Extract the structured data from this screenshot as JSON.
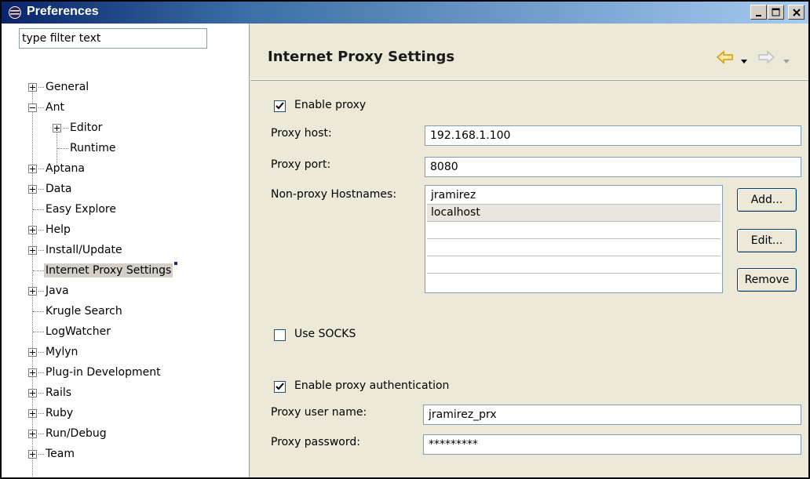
{
  "window": {
    "title": "Preferences",
    "controls": [
      "minimize",
      "maximize",
      "close"
    ]
  },
  "filter": {
    "placeholder": "type filter text",
    "value": "type filter text"
  },
  "tree": {
    "items": [
      {
        "label": "General",
        "expander": "plus"
      },
      {
        "label": "Ant",
        "expander": "minus"
      },
      {
        "label": "Editor",
        "expander": "plus"
      },
      {
        "label": "Runtime",
        "expander": "none"
      },
      {
        "label": "Aptana",
        "expander": "plus"
      },
      {
        "label": "Data",
        "expander": "plus"
      },
      {
        "label": "Easy Explore",
        "expander": "none"
      },
      {
        "label": "Help",
        "expander": "plus"
      },
      {
        "label": "Install/Update",
        "expander": "plus"
      },
      {
        "label": "Internet Proxy Settings",
        "expander": "none",
        "selected": true
      },
      {
        "label": "Java",
        "expander": "plus"
      },
      {
        "label": "Krugle Search",
        "expander": "none"
      },
      {
        "label": "LogWatcher",
        "expander": "none"
      },
      {
        "label": "Mylyn",
        "expander": "plus"
      },
      {
        "label": "Plug-in Development",
        "expander": "plus"
      },
      {
        "label": "Rails",
        "expander": "plus"
      },
      {
        "label": "Ruby",
        "expander": "plus"
      },
      {
        "label": "Run/Debug",
        "expander": "plus"
      },
      {
        "label": "Team",
        "expander": "plus"
      }
    ]
  },
  "page": {
    "title": "Internet Proxy Settings",
    "enable_proxy": {
      "label": "Enable proxy",
      "checked": true
    },
    "proxy_host": {
      "label": "Proxy host:",
      "value": "192.168.1.100"
    },
    "proxy_port": {
      "label": "Proxy port:",
      "value": "8080"
    },
    "non_proxy": {
      "label": "Non-proxy Hostnames:",
      "rows": [
        "jramirez",
        "localhost",
        "",
        "",
        "",
        ""
      ],
      "selected_index": 1
    },
    "buttons": {
      "add": "Add...",
      "edit": "Edit...",
      "remove": "Remove"
    },
    "use_socks": {
      "label": "Use SOCKS",
      "checked": false
    },
    "enable_auth": {
      "label": "Enable proxy authentication",
      "checked": true
    },
    "user_name": {
      "label": "Proxy user name:",
      "value": "jramirez_prx"
    },
    "password": {
      "label": "Proxy password:",
      "value": "*********"
    }
  },
  "colors": {
    "title_bar_start": "#0a246a",
    "title_bar_end": "#a6caf0",
    "panel_bg": "#ece9d8",
    "nav_back_arrow": "#f0b400"
  },
  "icons": [
    "eclipse-app-icon",
    "back-arrow-icon",
    "dropdown-icon",
    "forward-arrow-icon",
    "checkmark-icon"
  ]
}
